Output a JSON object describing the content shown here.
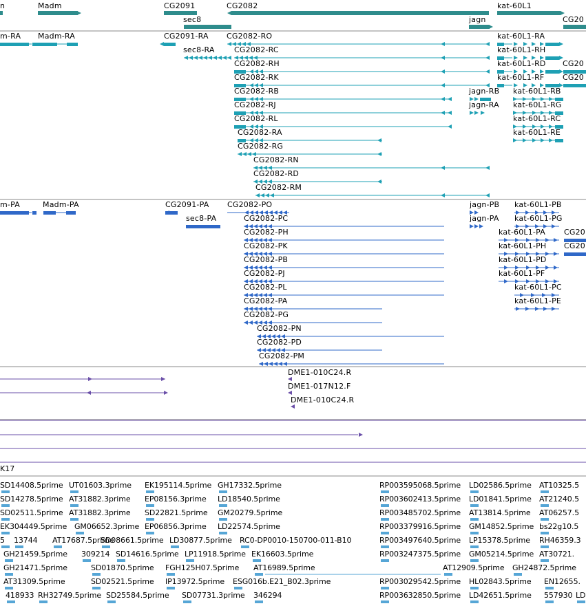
{
  "colors": {
    "gene": "#2e8c8c",
    "rna": "#1ea0b4",
    "protein": "#2f68c8",
    "est_track": "#6a4fa8",
    "est": "#56a6d6",
    "divider": "#8a8a8a"
  },
  "genes": [
    {
      "label": "n"
    },
    {
      "label": "Madm"
    },
    {
      "label": "CG2091"
    },
    {
      "label": "sec8"
    },
    {
      "label": "CG2082"
    },
    {
      "label": "jagn"
    },
    {
      "label": "kat-60L1"
    },
    {
      "label": "CG20"
    }
  ],
  "transcripts": [
    {
      "label": "m-RA"
    },
    {
      "label": "Madm-RA"
    },
    {
      "label": "CG2091-RA"
    },
    {
      "label": "sec8-RA"
    },
    {
      "label": "CG2082-RO"
    },
    {
      "label": "CG2082-RC"
    },
    {
      "label": "CG2082-RH"
    },
    {
      "label": "CG2082-RK"
    },
    {
      "label": "CG2082-RB"
    },
    {
      "label": "CG2082-RJ"
    },
    {
      "label": "CG2082-RL"
    },
    {
      "label": "CG2082-RA"
    },
    {
      "label": "CG2082-RG"
    },
    {
      "label": "CG2082-RN"
    },
    {
      "label": "CG2082-RD"
    },
    {
      "label": "CG2082-RM"
    },
    {
      "label": "jagn-RB"
    },
    {
      "label": "jagn-RA"
    },
    {
      "label": "kat-60L1-RA"
    },
    {
      "label": "kat-60L1-RH"
    },
    {
      "label": "kat-60L1-RD"
    },
    {
      "label": "kat-60L1-RF"
    },
    {
      "label": "kat-60L1-RB"
    },
    {
      "label": "kat-60L1-RG"
    },
    {
      "label": "kat-60L1-RC"
    },
    {
      "label": "kat-60L1-RE"
    },
    {
      "label": "CG20"
    },
    {
      "label": "CG20"
    }
  ],
  "proteins": [
    {
      "label": "m-PA"
    },
    {
      "label": "Madm-PA"
    },
    {
      "label": "CG2091-PA"
    },
    {
      "label": "sec8-PA"
    },
    {
      "label": "CG2082-PO"
    },
    {
      "label": "CG2082-PC"
    },
    {
      "label": "CG2082-PH"
    },
    {
      "label": "CG2082-PK"
    },
    {
      "label": "CG2082-PB"
    },
    {
      "label": "CG2082-PJ"
    },
    {
      "label": "CG2082-PL"
    },
    {
      "label": "CG2082-PA"
    },
    {
      "label": "CG2082-PG"
    },
    {
      "label": "CG2082-PN"
    },
    {
      "label": "CG2082-PD"
    },
    {
      "label": "CG2082-PM"
    },
    {
      "label": "jagn-PB"
    },
    {
      "label": "jagn-PA"
    },
    {
      "label": "kat-60L1-PB"
    },
    {
      "label": "kat-60L1-PG"
    },
    {
      "label": "kat-60L1-PA"
    },
    {
      "label": "kat-60L1-PH"
    },
    {
      "label": "kat-60L1-PD"
    },
    {
      "label": "kat-60L1-PF"
    },
    {
      "label": "kat-60L1-PC"
    },
    {
      "label": "kat-60L1-PE"
    },
    {
      "label": "CG20"
    },
    {
      "label": "CG20"
    }
  ],
  "clones": [
    {
      "label": "DME1-010C24.R"
    },
    {
      "label": "DME1-017N12.F"
    },
    {
      "label": "DME1-010C24.R"
    }
  ],
  "track_label": "K17",
  "ests": [
    [
      "SD14408.5prime",
      "UT01603.3prime",
      "EK195114.5prime",
      "GH17332.5prime",
      "RP003595068.5prime",
      "LD02586.5prime",
      "AT10325.5"
    ],
    [
      "SD14278.5prime",
      "AT31882.3prime",
      "EP08156.3prime",
      "LD18540.5prime",
      "RP003602413.5prime",
      "LD01841.5prime",
      "AT21240.5"
    ],
    [
      "SD02511.5prime",
      "AT31882.3prime",
      "SD22821.5prime",
      "GM20279.5prime",
      "RP003485702.5prime",
      "AT13814.5prime",
      "AT06257.5"
    ],
    [
      "EK304449.5prime",
      "GM06652.3prime",
      "EP06856.3prime",
      "LD22574.5prime",
      "RP003379916.5prime",
      "GM14852.5prime",
      "bs22g10.5"
    ],
    [
      "5",
      "13744",
      "AT17687.5prime",
      "SD08661.5prime",
      "LD30877.5prime",
      "RC0-DP0010-150700-011-B10",
      "RP003497640.5prime",
      "LP15378.5prime",
      "RH46359.3"
    ],
    [
      "GH21459.5prime",
      "309214",
      "SD14616.5prime",
      "LP11918.5prime",
      "EK16603.5prime",
      "RP003247375.5prime",
      "GM05214.5prime",
      "AT30721."
    ],
    [
      "GH21471.5prime",
      "SD01870.5prime",
      "FGH125H07.5prime",
      "AT16989.5prime",
      "AT12909.5prime",
      "GH24872.5prime"
    ],
    [
      "AT31309.5prime",
      "SD02521.5prime",
      "IP13972.5prime",
      "ESG016b.E21_B02.3prime",
      "RP003029542.5prime",
      "HL02843.5prime",
      "EN12655."
    ],
    [
      "418933",
      "RH32749.5prime",
      "SD25584.5prime",
      "SD07731.3prime",
      "346294",
      "RP003632850.5prime",
      "LD42651.5prime",
      "557930",
      "LD"
    ]
  ]
}
